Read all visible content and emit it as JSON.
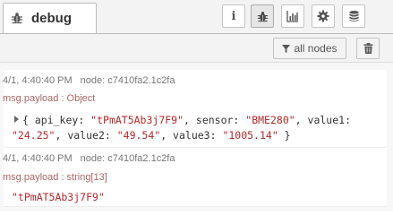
{
  "tab": {
    "label": "debug",
    "icon": "bug-icon"
  },
  "header_buttons": [
    {
      "icon": "info-icon",
      "glyph": "i"
    },
    {
      "icon": "bug-icon"
    },
    {
      "icon": "bar-chart-icon"
    },
    {
      "icon": "gear-icon"
    },
    {
      "icon": "database-icon"
    }
  ],
  "toolbar": {
    "filter_label": "all nodes",
    "filter_icon": "filter-icon",
    "clear_icon": "trash-icon"
  },
  "messages": [
    {
      "timestamp": "4/1, 4:40:40 PM",
      "node": "node: c7410fa2.1c2fa",
      "topic": "msg.payload : Object",
      "payload": {
        "open": "{ ",
        "key1": "api_key: ",
        "val1": "\"tPmAT5Ab3j7F9\"",
        "sep1": ", ",
        "key2": "sensor: ",
        "val2": "\"BME280\"",
        "sep2": ", ",
        "key3": "value1:",
        "val3": "\"24.25\"",
        "sep3": ", ",
        "key4": "value2: ",
        "val4": "\"49.54\"",
        "sep4": ", ",
        "key5": "value3: ",
        "val5": "\"1005.14\"",
        "close": " }"
      }
    },
    {
      "timestamp": "4/1, 4:40:40 PM",
      "node": "node: c7410fa2.1c2fa",
      "topic": "msg.payload : string[13]",
      "payload": {
        "text": "\"tPmAT5Ab3j7F9\""
      }
    }
  ],
  "colors": {
    "string": "#b72828",
    "topic": "#aa6666",
    "meta": "#777777"
  }
}
